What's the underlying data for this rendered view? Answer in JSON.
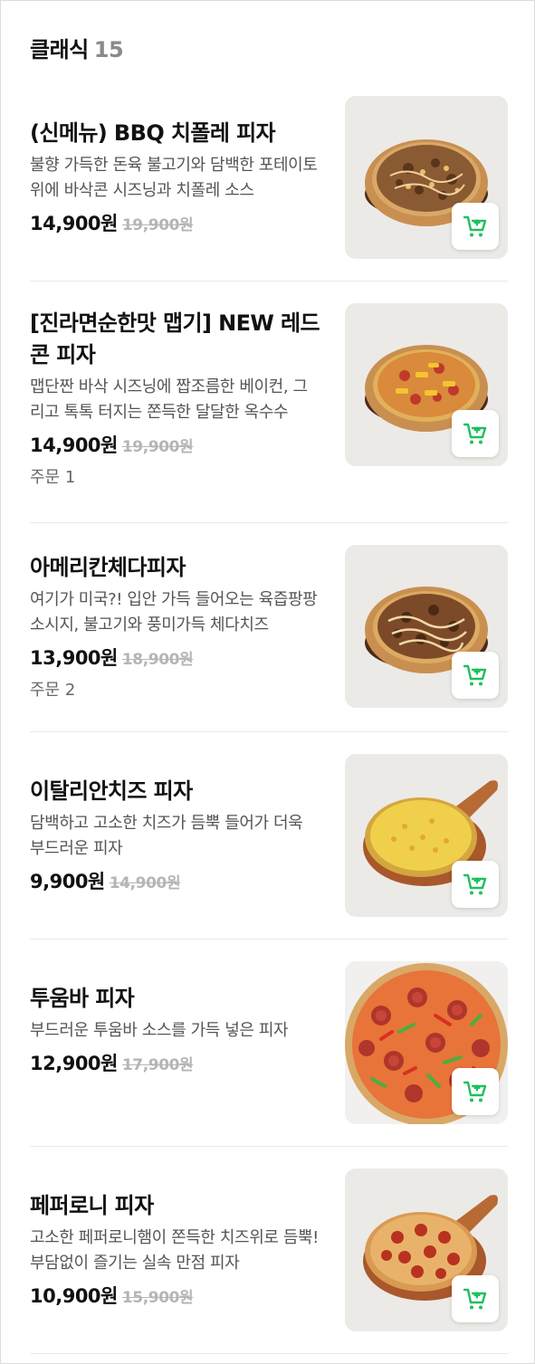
{
  "section": {
    "title": "클래식",
    "count": "15"
  },
  "accent_color": "#1fbf5f",
  "cart_icon": "cart-add-icon",
  "items": [
    {
      "name": "(신메뉴) BBQ 치폴레 피자",
      "description": "불향 가득한 돈육 불고기와 담백한 포테이토 위에 바삭콘 시즈닝과 치폴레 소스",
      "price": "14,900원",
      "original_price": "19,900원",
      "orders": ""
    },
    {
      "name": "[진라면순한맛 맵기] NEW 레드콘 피자",
      "description": "맵단짠 바삭 시즈닝에 짭조름한 베이컨, 그리고 톡톡 터지는 쫀득한 달달한 옥수수",
      "price": "14,900원",
      "original_price": "19,900원",
      "orders": "주문 1"
    },
    {
      "name": "아메리칸체다피자",
      "description": "여기가 미국?! 입안 가득 들어오는 육즙팡팡 소시지, 불고기와 풍미가득 체다치즈",
      "price": "13,900원",
      "original_price": "18,900원",
      "orders": "주문 2"
    },
    {
      "name": "이탈리안치즈 피자",
      "description": "담백하고 고소한 치즈가 듬뿍 들어가 더욱 부드러운 피자",
      "price": "9,900원",
      "original_price": "14,900원",
      "orders": ""
    },
    {
      "name": "투움바 피자",
      "description": "부드러운 투움바 소스를 가득 넣은 피자",
      "price": "12,900원",
      "original_price": "17,900원",
      "orders": ""
    },
    {
      "name": "페퍼로니 피자",
      "description": "고소한 페퍼로니햄이 쫀득한 치즈위로 듬뿍! 부담없이 즐기는 실속 만점 피자",
      "price": "10,900원",
      "original_price": "15,900원",
      "orders": ""
    }
  ]
}
